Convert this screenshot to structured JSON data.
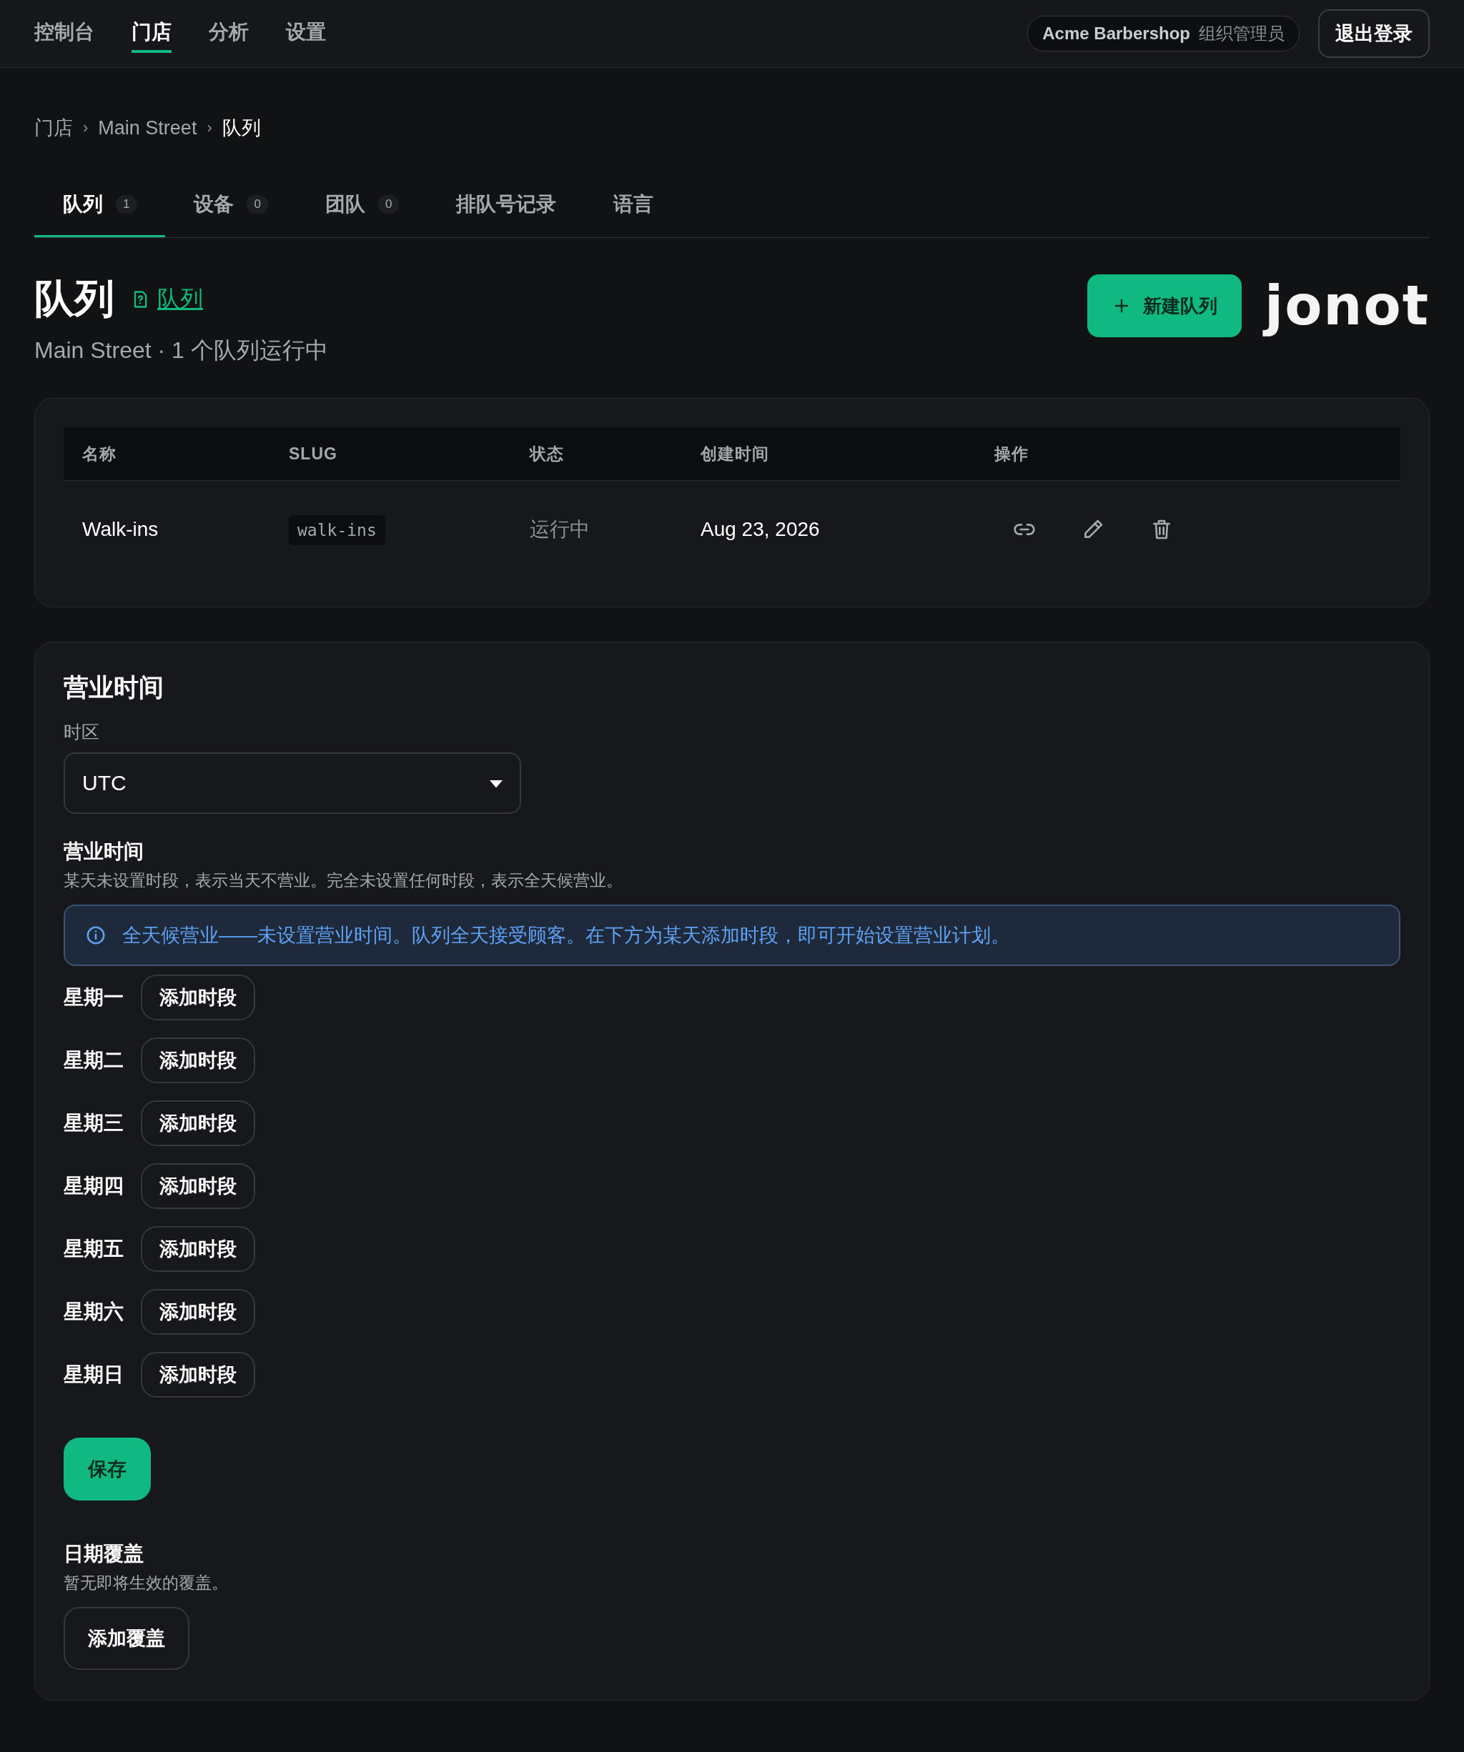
{
  "nav": {
    "items": [
      {
        "label": "控制台",
        "selected": false
      },
      {
        "label": "门店",
        "selected": true
      },
      {
        "label": "分析",
        "selected": false
      },
      {
        "label": "设置",
        "selected": false
      }
    ],
    "org": {
      "name": "Acme Barbershop",
      "role": "组织管理员"
    },
    "logout": "退出登录"
  },
  "breadcrumb": {
    "separator": "›",
    "items": [
      {
        "label": "门店",
        "current": false
      },
      {
        "label": "Main Street",
        "current": false
      },
      {
        "label": "队列",
        "current": true
      }
    ]
  },
  "tabs": [
    {
      "label": "队列",
      "count": "1",
      "selected": true
    },
    {
      "label": "设备",
      "count": "0",
      "selected": false
    },
    {
      "label": "团队",
      "count": "0",
      "selected": false
    },
    {
      "label": "排队号记录",
      "selected": false
    },
    {
      "label": "语言",
      "selected": false
    }
  ],
  "header": {
    "title": "队列",
    "help_link": "队列",
    "subtitle": "Main Street · 1 个队列运行中",
    "new_button": "新建队列",
    "logo": "jonot"
  },
  "table": {
    "columns": [
      "名称",
      "SLUG",
      "状态",
      "创建时间",
      "操作"
    ],
    "rows": [
      {
        "name": "Walk-ins",
        "slug": "walk-ins",
        "status": "运行中",
        "created": "Aug 23, 2026"
      }
    ]
  },
  "hours": {
    "title": "营业时间",
    "timezone_label": "时区",
    "timezone_value": "UTC",
    "section_title": "营业时间",
    "section_desc": "某天未设置时段，表示当天不营业。完全未设置任何时段，表示全天候营业。",
    "info": "全天候营业——未设置营业时间。队列全天接受顾客。在下方为某天添加时段，即可开始设置营业计划。",
    "days": [
      {
        "label": "星期一",
        "button": "添加时段"
      },
      {
        "label": "星期二",
        "button": "添加时段"
      },
      {
        "label": "星期三",
        "button": "添加时段"
      },
      {
        "label": "星期四",
        "button": "添加时段"
      },
      {
        "label": "星期五",
        "button": "添加时段"
      },
      {
        "label": "星期六",
        "button": "添加时段"
      },
      {
        "label": "星期日",
        "button": "添加时段"
      }
    ],
    "save": "保存",
    "overrides": {
      "title": "日期覆盖",
      "desc": "暂无即将生效的覆盖。",
      "button": "添加覆盖"
    }
  }
}
